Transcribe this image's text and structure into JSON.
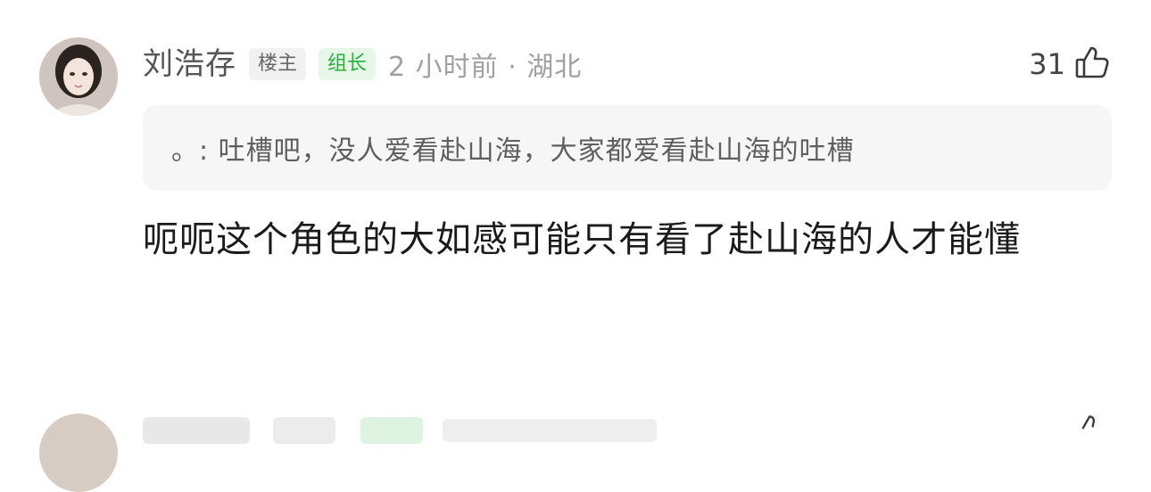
{
  "comment": {
    "username": "刘浩存",
    "tag_op": "楼主",
    "tag_leader": "组长",
    "meta": "2 小时前 · 湖北",
    "like_count": "31",
    "like_icon": "thumb-up-icon",
    "quote": "。: 吐槽吧，没人爱看赴山海，大家都爱看赴山海的吐槽",
    "body": "呃呃这个角色的大如感可能只有看了赴山海的人才能懂"
  },
  "colors": {
    "tag_leader_text": "#27ae3f",
    "tag_leader_bg": "#e6f7e7",
    "quote_bg": "#f6f6f6"
  }
}
